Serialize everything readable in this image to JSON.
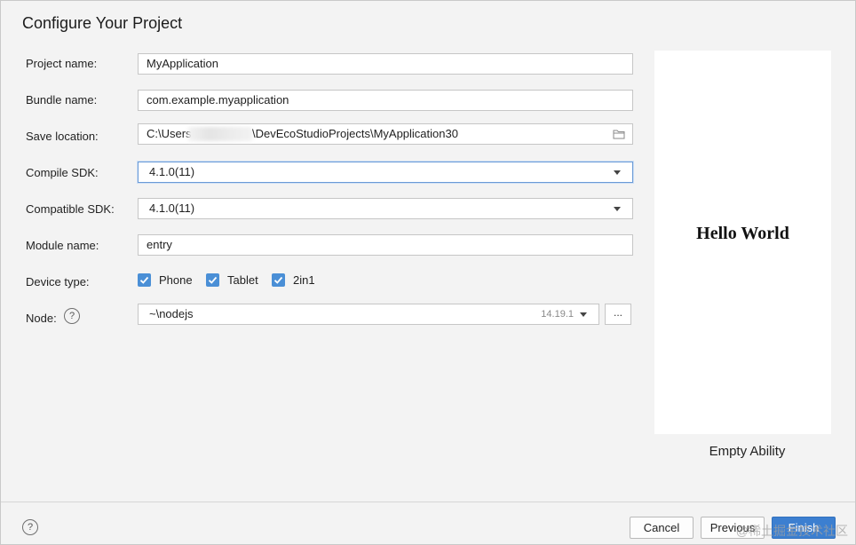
{
  "dialog": {
    "title": "Configure Your Project"
  },
  "form": {
    "project_name": {
      "label": "Project name:",
      "value": "MyApplication"
    },
    "bundle_name": {
      "label": "Bundle name:",
      "value": "com.example.myapplication"
    },
    "save_location": {
      "label": "Save location:",
      "value_prefix": "C:\\Users",
      "value_suffix": "\\DevEcoStudioProjects\\MyApplication30"
    },
    "compile_sdk": {
      "label": "Compile SDK:",
      "value": "4.1.0(11)"
    },
    "compatible_sdk": {
      "label": "Compatible SDK:",
      "value": "4.1.0(11)"
    },
    "module_name": {
      "label": "Module name:",
      "value": "entry"
    },
    "device_type": {
      "label": "Device type:",
      "options": [
        {
          "label": "Phone",
          "checked": true
        },
        {
          "label": "Tablet",
          "checked": true
        },
        {
          "label": "2in1",
          "checked": true
        }
      ]
    },
    "node": {
      "label": "Node:",
      "value": "~\\nodejs",
      "version": "14.19.1",
      "browse_label": "..."
    }
  },
  "preview": {
    "text": "Hello World",
    "caption": "Empty Ability"
  },
  "footer": {
    "cancel_label": "Cancel",
    "previous_label": "Previous",
    "finish_label": "Finish"
  },
  "watermark": "@稀土掘金技术社区",
  "colors": {
    "accent": "#3c7fd0",
    "checkbox": "#4a8fd6"
  }
}
